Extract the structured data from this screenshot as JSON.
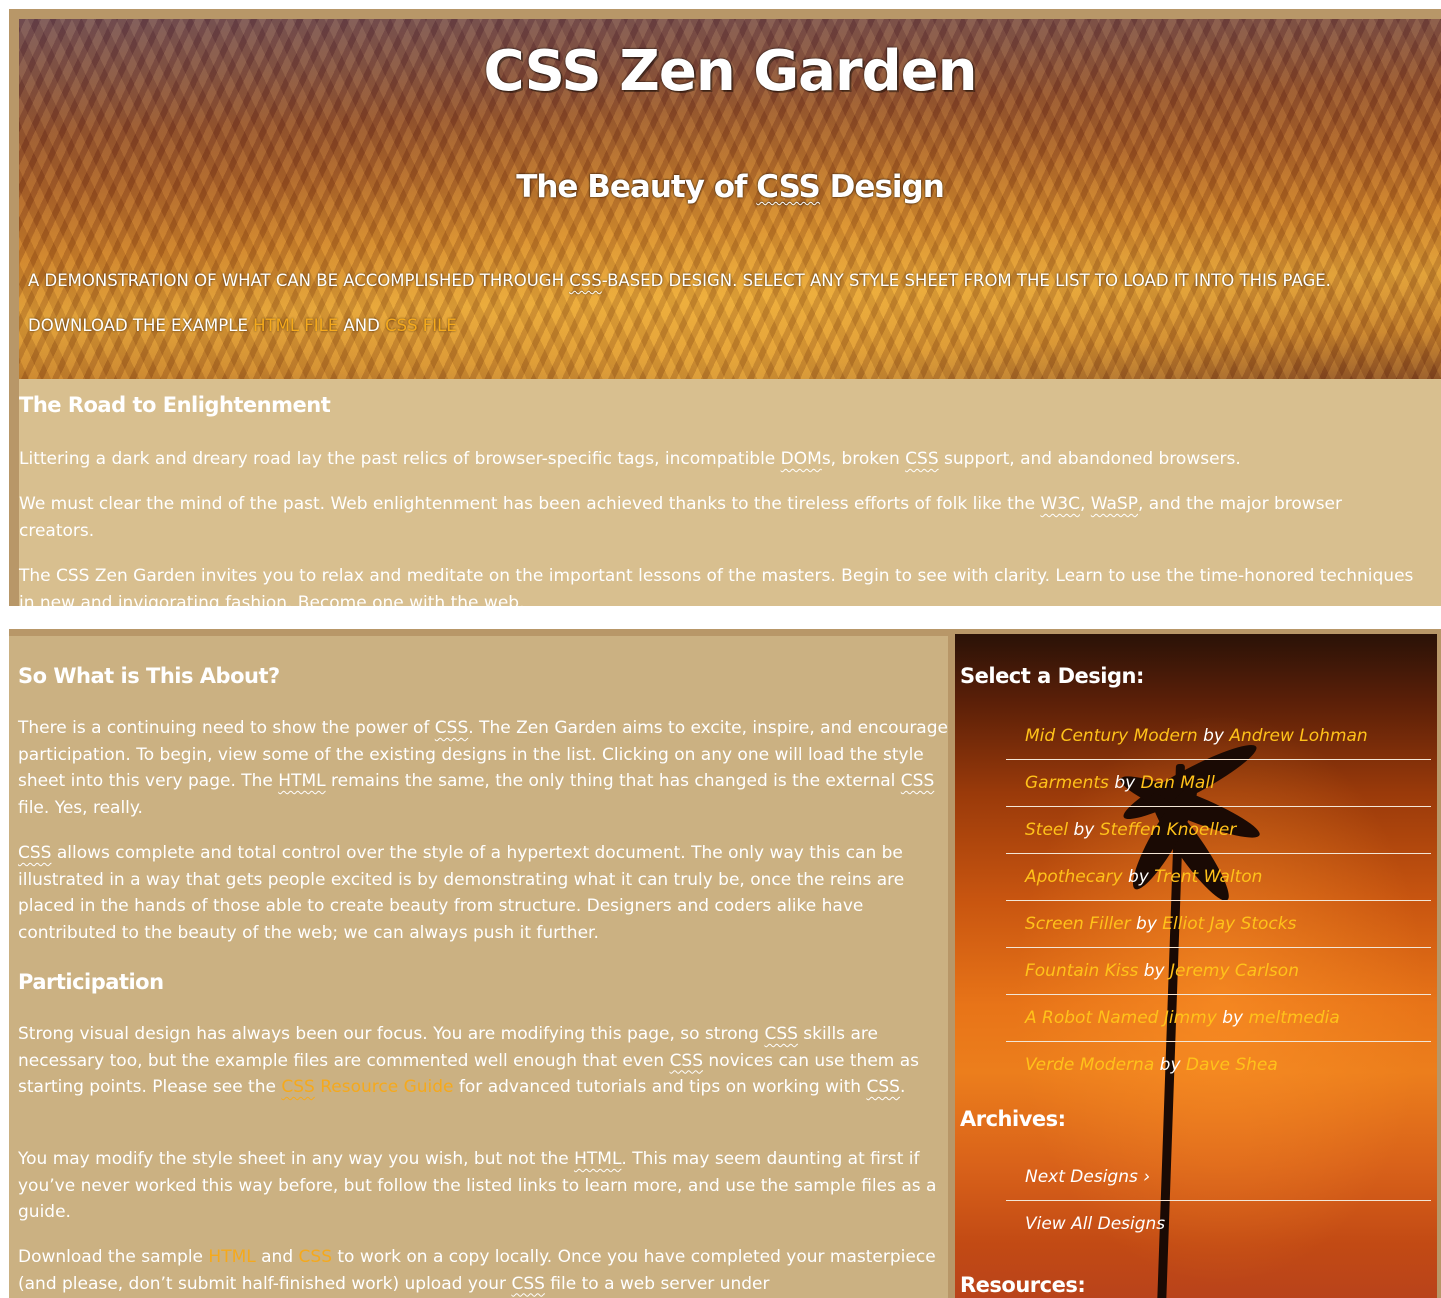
{
  "header": {
    "site_title": "CSS Zen Garden",
    "tagline_pre": "The Beauty of ",
    "tagline_abbr": "CSS",
    "tagline_post": " Design"
  },
  "intro": {
    "line1_pre": "A demonstration of what can be accomplished through ",
    "line1_abbr": "CSS",
    "line1_post": "-based design. Select any style sheet from the list to load it into this page.",
    "line2_pre": "Download the example ",
    "html_file_link": "html file",
    "line2_mid": " and ",
    "css_file_link": "css file"
  },
  "preamble": {
    "heading": "The Road to Enlightenment",
    "p1_a": "Littering a dark and dreary road lay the past relics of browser-specific tags, incompatible ",
    "p1_abbr1": "DOM",
    "p1_b": "s, broken ",
    "p1_abbr2": "CSS",
    "p1_c": " support, and abandoned browsers.",
    "p2_a": "We must clear the mind of the past. Web enlightenment has been achieved thanks to the tireless efforts of folk like the ",
    "p2_abbr1": "W3C",
    "p2_b": ", ",
    "p2_abbr2": "WaSP",
    "p2_c": ", and the major browser creators.",
    "p3": "The CSS Zen Garden invites you to relax and meditate on the important lessons of the masters. Begin to see with clarity. Learn to use the time-honored techniques in new and invigorating fashion. Become one with the web."
  },
  "about": {
    "heading": "So What is This About?",
    "p1_a": "There is a continuing need to show the power of ",
    "p1_abbr1": "CSS",
    "p1_b": ". The Zen Garden aims to excite, inspire, and encourage participation. To begin, view some of the existing designs in the list. Clicking on any one will load the style sheet into this very page. The ",
    "p1_abbr2": "HTML",
    "p1_c": " remains the same, the only thing that has changed is the external ",
    "p1_abbr3": "CSS",
    "p1_d": " file. Yes, really.",
    "p2_abbr": "CSS",
    "p2": " allows complete and total control over the style of a hypertext document. The only way this can be illustrated in a way that gets people excited is by demonstrating what it can truly be, once the reins are placed in the hands of those able to create beauty from structure. Designers and coders alike have contributed to the beauty of the web; we can always push it further."
  },
  "participation": {
    "heading": "Participation",
    "p1_a": "Strong visual design has always been our focus. You are modifying this page, so strong ",
    "p1_abbr1": "CSS",
    "p1_b": " skills are necessary too, but the example files are commented well enough that even ",
    "p1_abbr2": "CSS",
    "p1_c": " novices can use them as starting points. Please see the ",
    "p1_link_abbr": "CSS",
    "p1_link": " Resource Guide",
    "p1_d": " for advanced tutorials and tips on working with ",
    "p1_abbr3": "CSS",
    "p1_e": ".",
    "p2_a": "You may modify the style sheet in any way you wish, but not the ",
    "p2_abbr": "HTML",
    "p2_b": ". This may seem daunting at first if you’ve never worked this way before, but follow the listed links to learn more, and use the sample files as a guide.",
    "p3_a": "Download the sample ",
    "p3_link1": "HTML",
    "p3_b": " and ",
    "p3_link2": "CSS",
    "p3_c": " to work on a copy locally. Once you have completed your masterpiece (and please, don’t submit half-finished work) upload your ",
    "p3_abbr": "CSS",
    "p3_d": " file to a web server under"
  },
  "sidebar": {
    "select_heading": "Select a Design:",
    "by_label": "by",
    "designs": [
      {
        "name": "Mid Century Modern",
        "author": "Andrew Lohman"
      },
      {
        "name": "Garments",
        "author": "Dan Mall"
      },
      {
        "name": "Steel",
        "author": "Steffen Knoeller"
      },
      {
        "name": "Apothecary",
        "author": "Trent Walton"
      },
      {
        "name": "Screen Filler",
        "author": "Elliot Jay Stocks"
      },
      {
        "name": "Fountain Kiss",
        "author": "Jeremy Carlson"
      },
      {
        "name": "A Robot Named Jimmy",
        "author": "meltmedia"
      },
      {
        "name": "Verde Moderna",
        "author": "Dave Shea"
      }
    ],
    "archives_heading": "Archives:",
    "next_designs": "Next Designs ›",
    "view_all": "View All Designs",
    "resources_heading": "Resources:"
  },
  "colors": {
    "panel_tan": "#d8bf8f",
    "panel_border": "#b89768",
    "main_col_bg": "#cbb182",
    "link_gold": "#f5a91c",
    "design_gold": "#ffc21a"
  }
}
